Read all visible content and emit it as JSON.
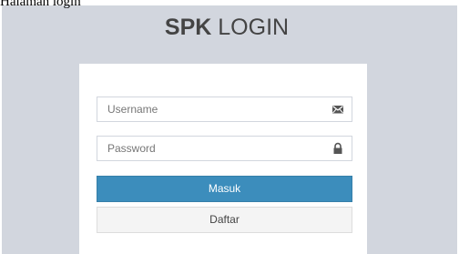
{
  "caption": "Halaman login",
  "brand": {
    "strong": "SPK",
    "light": "LOGIN"
  },
  "form": {
    "username": {
      "placeholder": "Username",
      "value": "",
      "icon": "envelope-icon"
    },
    "password": {
      "placeholder": "Password",
      "value": "",
      "icon": "lock-icon"
    },
    "login_button": "Masuk",
    "register_button": "Daftar"
  },
  "colors": {
    "background": "#d2d6de",
    "primary": "#3c8dbc",
    "default_button": "#f4f4f4",
    "text": "#444444"
  }
}
